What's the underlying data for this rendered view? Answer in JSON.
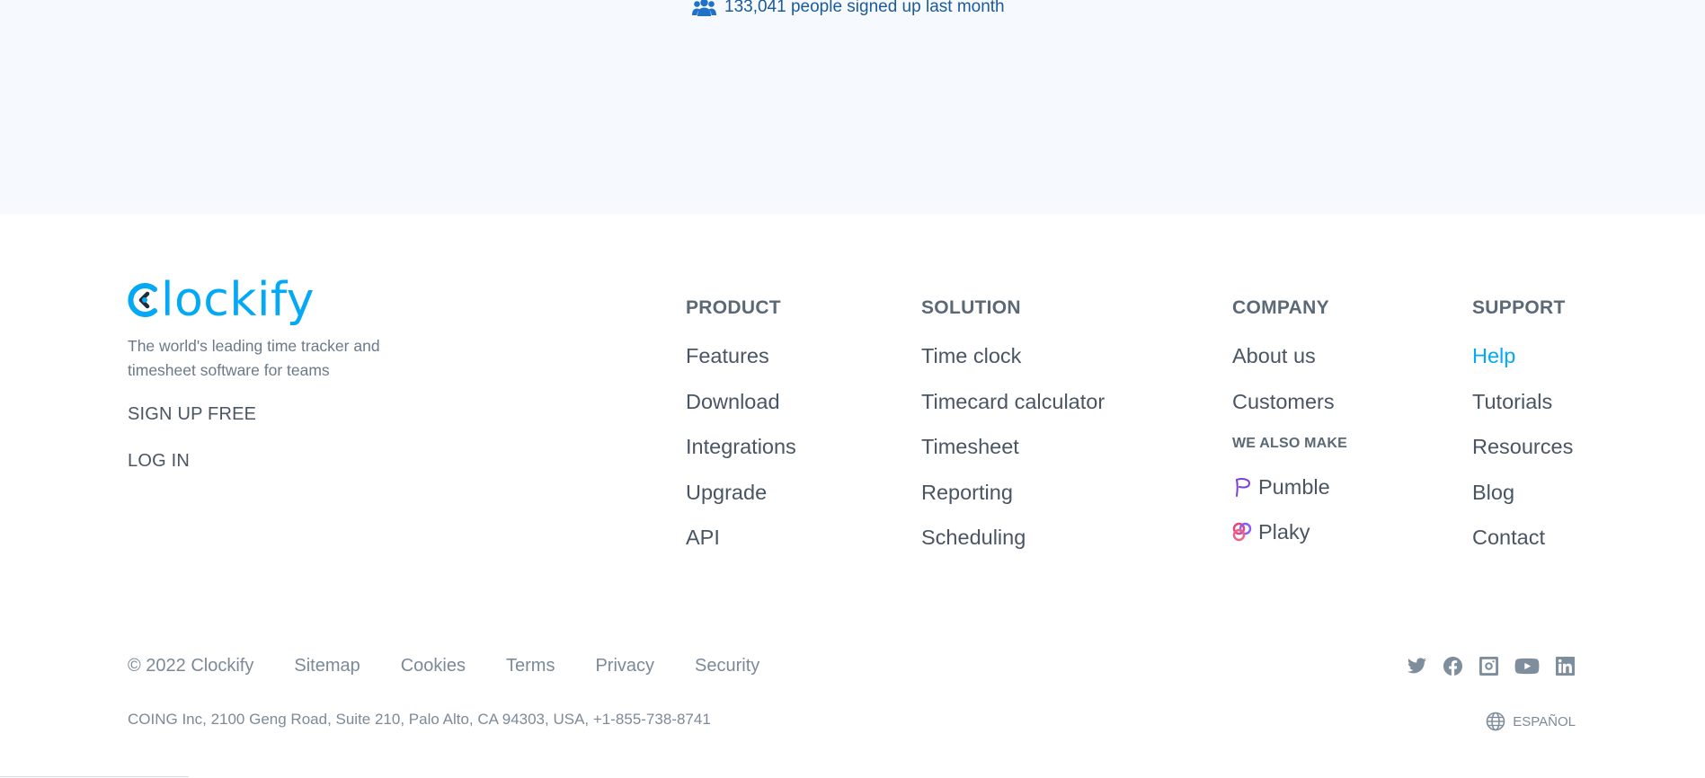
{
  "signups": {
    "text": "133,041 people signed up last month",
    "icon": "users-icon"
  },
  "brand": {
    "logo_text": "lockify",
    "logo_alt": "Clockify",
    "tagline": "The world's leading time tracker and timesheet software for teams",
    "signup_label": "SIGN UP FREE",
    "login_label": "LOG IN",
    "accent_color": "#03a9f4"
  },
  "columns": {
    "product": {
      "heading": "PRODUCT",
      "links": [
        "Features",
        "Download",
        "Integrations",
        "Upgrade",
        "API"
      ]
    },
    "solution": {
      "heading": "SOLUTION",
      "links": [
        "Time clock",
        "Timecard calculator",
        "Timesheet",
        "Reporting",
        "Scheduling"
      ]
    },
    "company": {
      "heading": "COMPANY",
      "links": [
        "About us",
        "Customers"
      ],
      "also_make_heading": "WE ALSO MAKE",
      "products": [
        {
          "label": "Pumble",
          "icon": "pumble-icon"
        },
        {
          "label": "Plaky",
          "icon": "plaky-icon"
        }
      ]
    },
    "support": {
      "heading": "SUPPORT",
      "links": [
        "Help",
        "Tutorials",
        "Resources",
        "Blog",
        "Contact"
      ],
      "active": "Help"
    }
  },
  "footer": {
    "copyright": "© 2022 Clockify",
    "links": [
      "Sitemap",
      "Cookies",
      "Terms",
      "Privacy",
      "Security"
    ],
    "address": "COING Inc, 2100 Geng Road, Suite 210, Palo Alto, CA 94303, USA, +1-855-738-8741",
    "language": "ESPAÑOL",
    "social": [
      "twitter-icon",
      "facebook-icon",
      "instagram-icon",
      "youtube-icon",
      "linkedin-icon"
    ]
  }
}
